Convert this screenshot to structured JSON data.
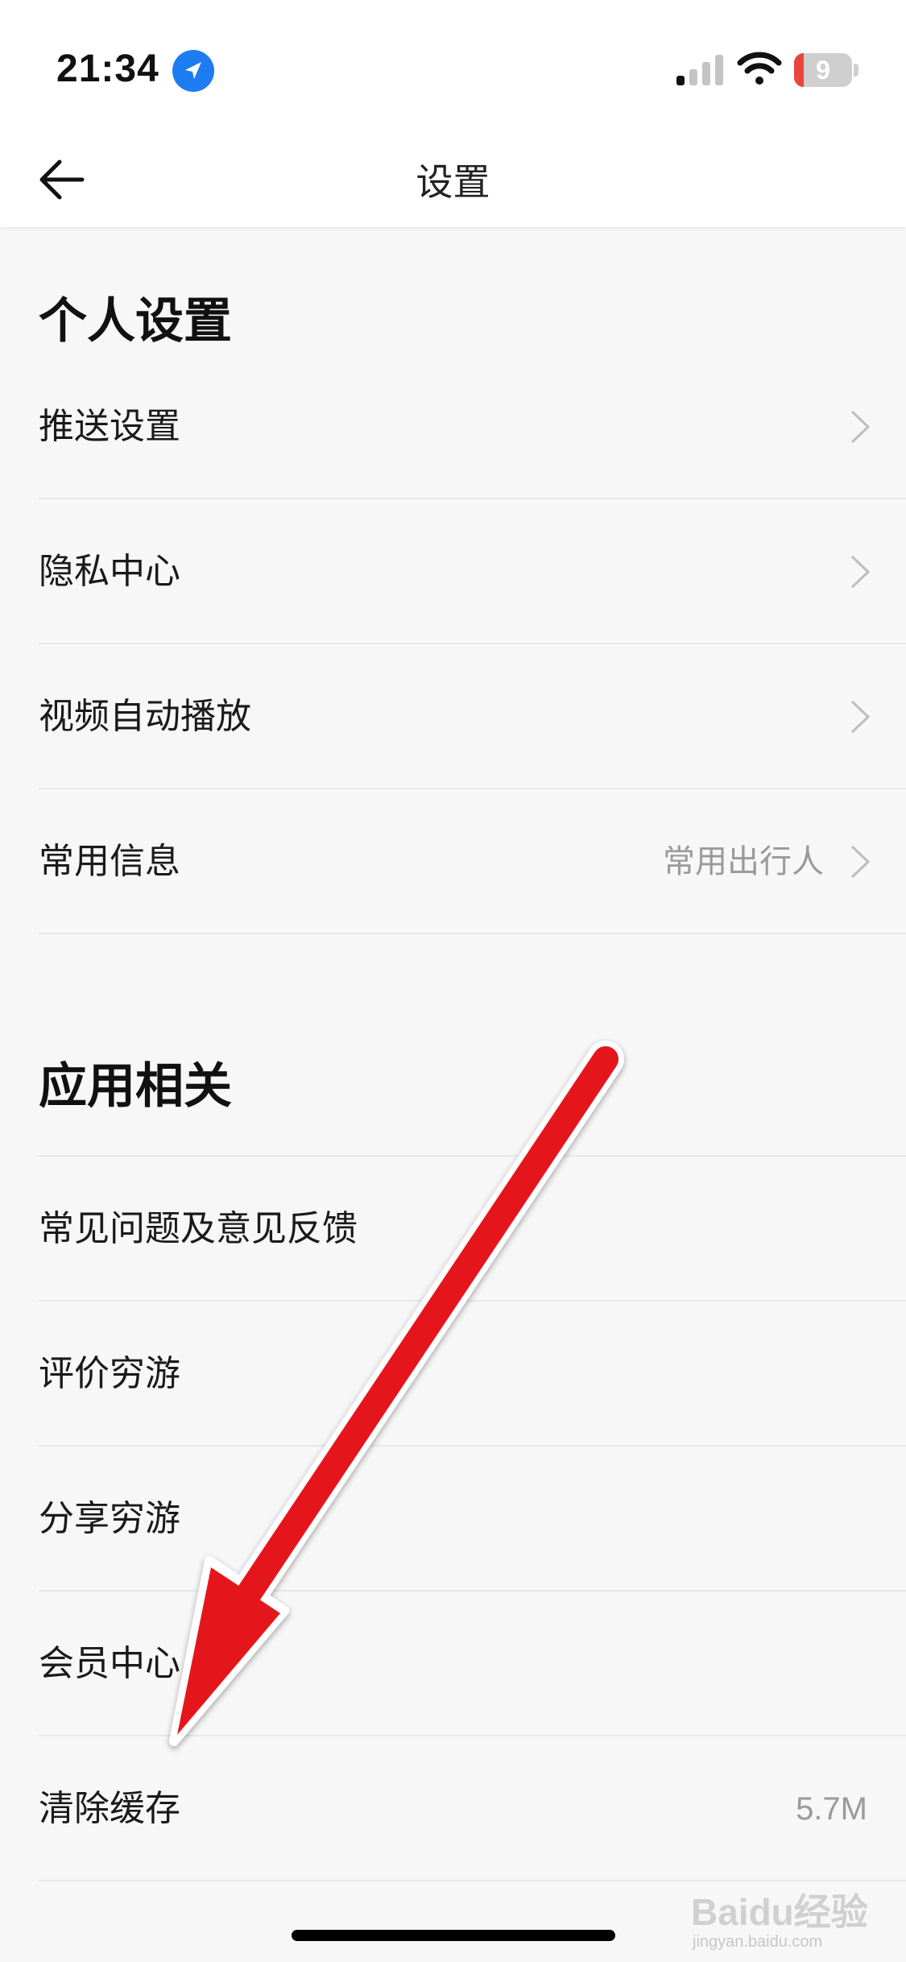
{
  "status_bar": {
    "time": "21:34",
    "battery_level": 9,
    "battery_text": "9",
    "battery_color": "#e9453b",
    "icons": [
      "location-icon",
      "signal-icon",
      "wifi-icon",
      "battery-icon"
    ]
  },
  "header": {
    "title": "设置",
    "back_icon": "arrow-left-icon"
  },
  "sections": [
    {
      "title": "个人设置",
      "items": [
        {
          "label": "推送设置",
          "value": "",
          "chevron": true
        },
        {
          "label": "隐私中心",
          "value": "",
          "chevron": true
        },
        {
          "label": "视频自动播放",
          "value": "",
          "chevron": true
        },
        {
          "label": "常用信息",
          "value": "常用出行人",
          "chevron": true
        }
      ]
    },
    {
      "title": "应用相关",
      "items": [
        {
          "label": "常见问题及意见反馈",
          "value": "",
          "chevron": false
        },
        {
          "label": "评价穷游",
          "value": "",
          "chevron": false
        },
        {
          "label": "分享穷游",
          "value": "",
          "chevron": false
        },
        {
          "label": "会员中心",
          "value": "",
          "chevron": false
        },
        {
          "label": "清除缓存",
          "value": "5.7M",
          "chevron": false
        }
      ]
    }
  ],
  "overlay": {
    "annotation": "red-arrow",
    "color": "#e4161b"
  },
  "watermark": {
    "text": "Baidu经验",
    "subtext": "jingyan.baidu.com"
  }
}
